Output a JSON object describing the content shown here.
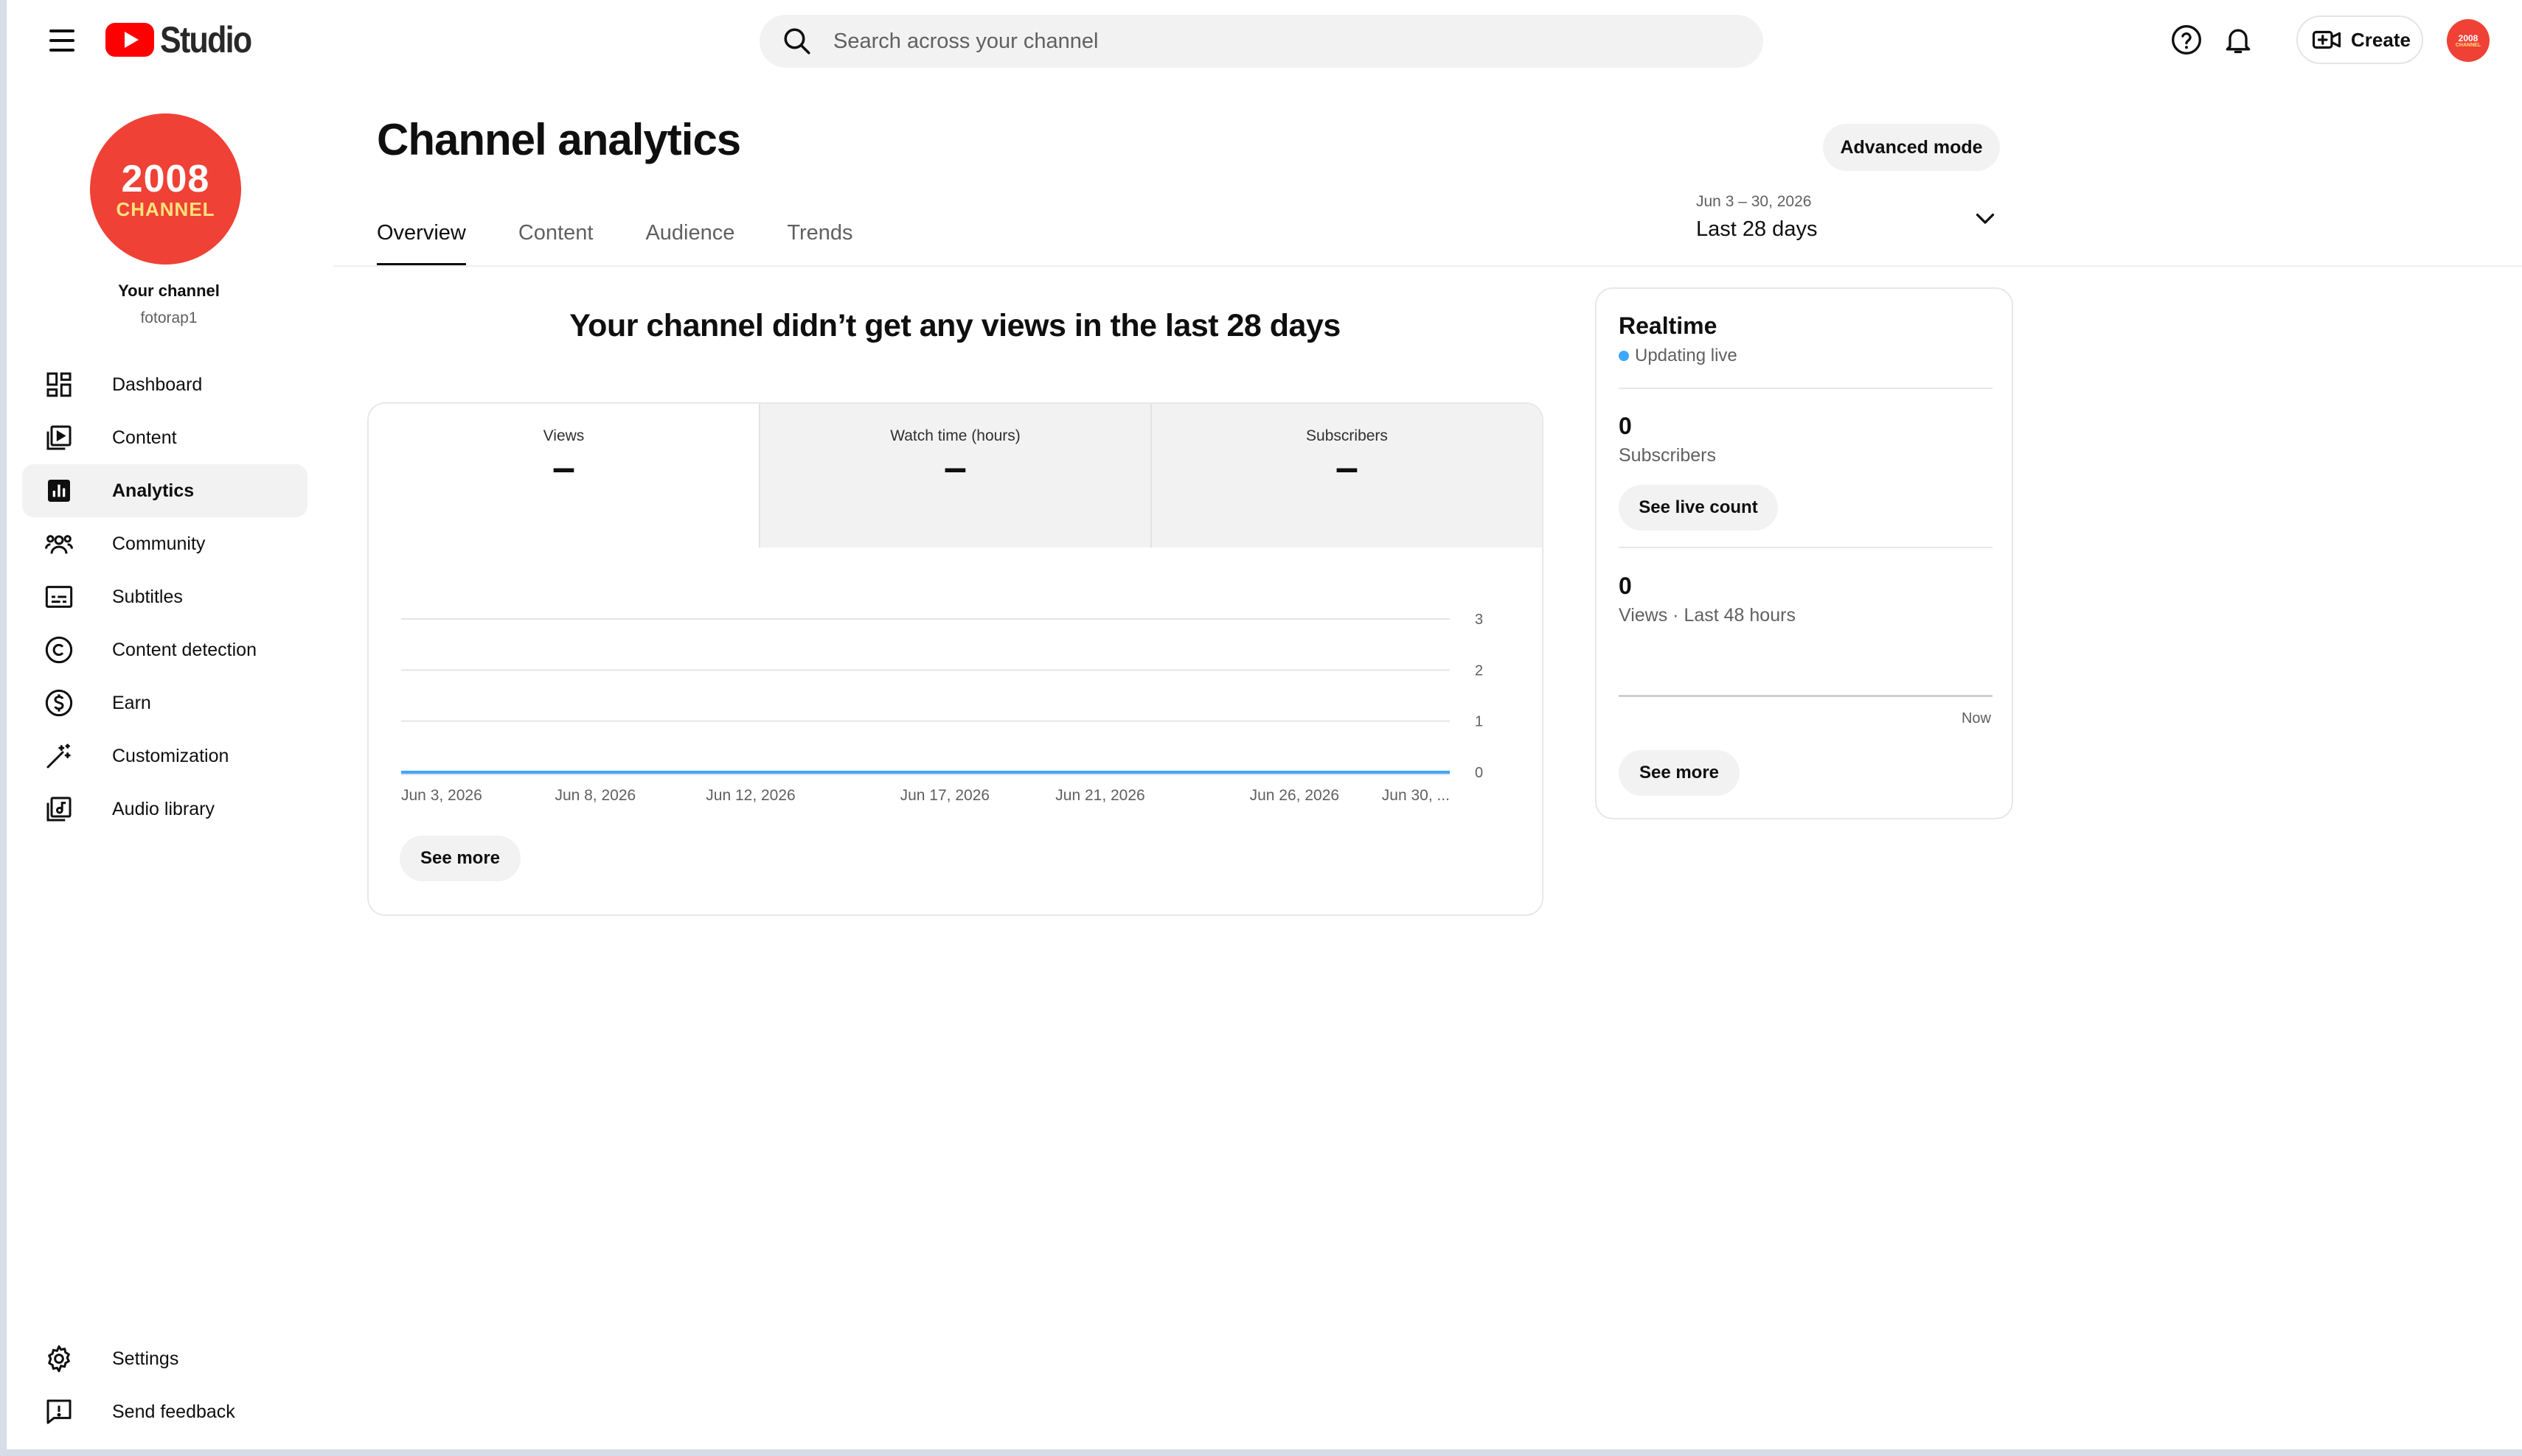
{
  "header": {
    "logo_text": "Studio",
    "search_placeholder": "Search across your channel",
    "create_label": "Create",
    "avatar_line1": "2008",
    "avatar_line2": "CHANNEL"
  },
  "sidebar": {
    "channel_avatar_line1": "2008",
    "channel_avatar_line2": "CHANNEL",
    "channel_title": "Your channel",
    "channel_handle": "fotorap1",
    "items": [
      {
        "label": "Dashboard",
        "icon": "dashboard-icon"
      },
      {
        "label": "Content",
        "icon": "content-icon"
      },
      {
        "label": "Analytics",
        "icon": "analytics-icon",
        "active": true
      },
      {
        "label": "Community",
        "icon": "community-icon"
      },
      {
        "label": "Subtitles",
        "icon": "subtitles-icon"
      },
      {
        "label": "Content detection",
        "icon": "copyright-icon"
      },
      {
        "label": "Earn",
        "icon": "dollar-icon"
      },
      {
        "label": "Customization",
        "icon": "magic-wand-icon"
      },
      {
        "label": "Audio library",
        "icon": "audio-library-icon"
      }
    ],
    "bottom_items": [
      {
        "label": "Settings",
        "icon": "gear-icon"
      },
      {
        "label": "Send feedback",
        "icon": "feedback-icon"
      }
    ]
  },
  "main": {
    "title": "Channel analytics",
    "advanced_mode_label": "Advanced mode",
    "tabs": [
      {
        "label": "Overview",
        "active": true
      },
      {
        "label": "Content"
      },
      {
        "label": "Audience"
      },
      {
        "label": "Trends"
      }
    ],
    "date_range": {
      "dates": "Jun 3 – 30, 2026",
      "label": "Last 28 days"
    },
    "headline": "Your channel didn’t get any views in the last 28 days",
    "metrics": [
      {
        "label": "Views",
        "value": "–",
        "active": true
      },
      {
        "label": "Watch time (hours)",
        "value": "–"
      },
      {
        "label": "Subscribers",
        "value": "–"
      }
    ],
    "see_more_label": "See more"
  },
  "chart_data": {
    "type": "line",
    "x_ticks": [
      "Jun 3, 2026",
      "Jun 8, 2026",
      "Jun 12, 2026",
      "Jun 17, 2026",
      "Jun 21, 2026",
      "Jun 26, 2026",
      "Jun 30, ..."
    ],
    "x_tick_positions": [
      0,
      5,
      9,
      14,
      18,
      23,
      27
    ],
    "y_ticks": [
      "0",
      "1",
      "2",
      "3"
    ],
    "ylim": [
      0,
      3
    ],
    "series": [
      {
        "values": [
          0,
          0,
          0,
          0,
          0,
          0,
          0,
          0,
          0,
          0,
          0,
          0,
          0,
          0,
          0,
          0,
          0,
          0,
          0,
          0,
          0,
          0,
          0,
          0,
          0,
          0,
          0,
          0
        ],
        "color": "#3ea6ff"
      }
    ],
    "grid": true
  },
  "realtime": {
    "title": "Realtime",
    "status": "Updating live",
    "subscribers_value": "0",
    "subscribers_label": "Subscribers",
    "live_count_label": "See live count",
    "views_value": "0",
    "views_label": "Views · Last 48 hours",
    "now_label": "Now",
    "see_more_label": "See more"
  },
  "colors": {
    "brand_red": "#ff0000",
    "accent_blue": "#3ea6ff",
    "avatar_red": "#ef4136"
  }
}
